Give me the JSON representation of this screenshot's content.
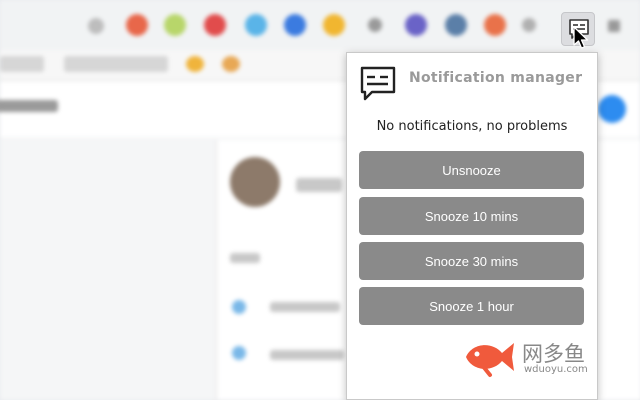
{
  "extension": {
    "button_icon": "notification-manager-icon"
  },
  "popup": {
    "title": "Notification manager",
    "message": "No notifications, no problems",
    "buttons": [
      {
        "label": "Unsnooze"
      },
      {
        "label": "Snooze 10 mins"
      },
      {
        "label": "Snooze 30 mins"
      },
      {
        "label": "Snooze 1 hour"
      }
    ]
  },
  "watermark": {
    "brand": "网多鱼",
    "url": "wduoyu.com"
  },
  "colors": {
    "button_bg": "#8a8a8a",
    "title": "#9a9a9a",
    "fish": "#f05a3c",
    "accent_blue": "#2d8cf0"
  }
}
